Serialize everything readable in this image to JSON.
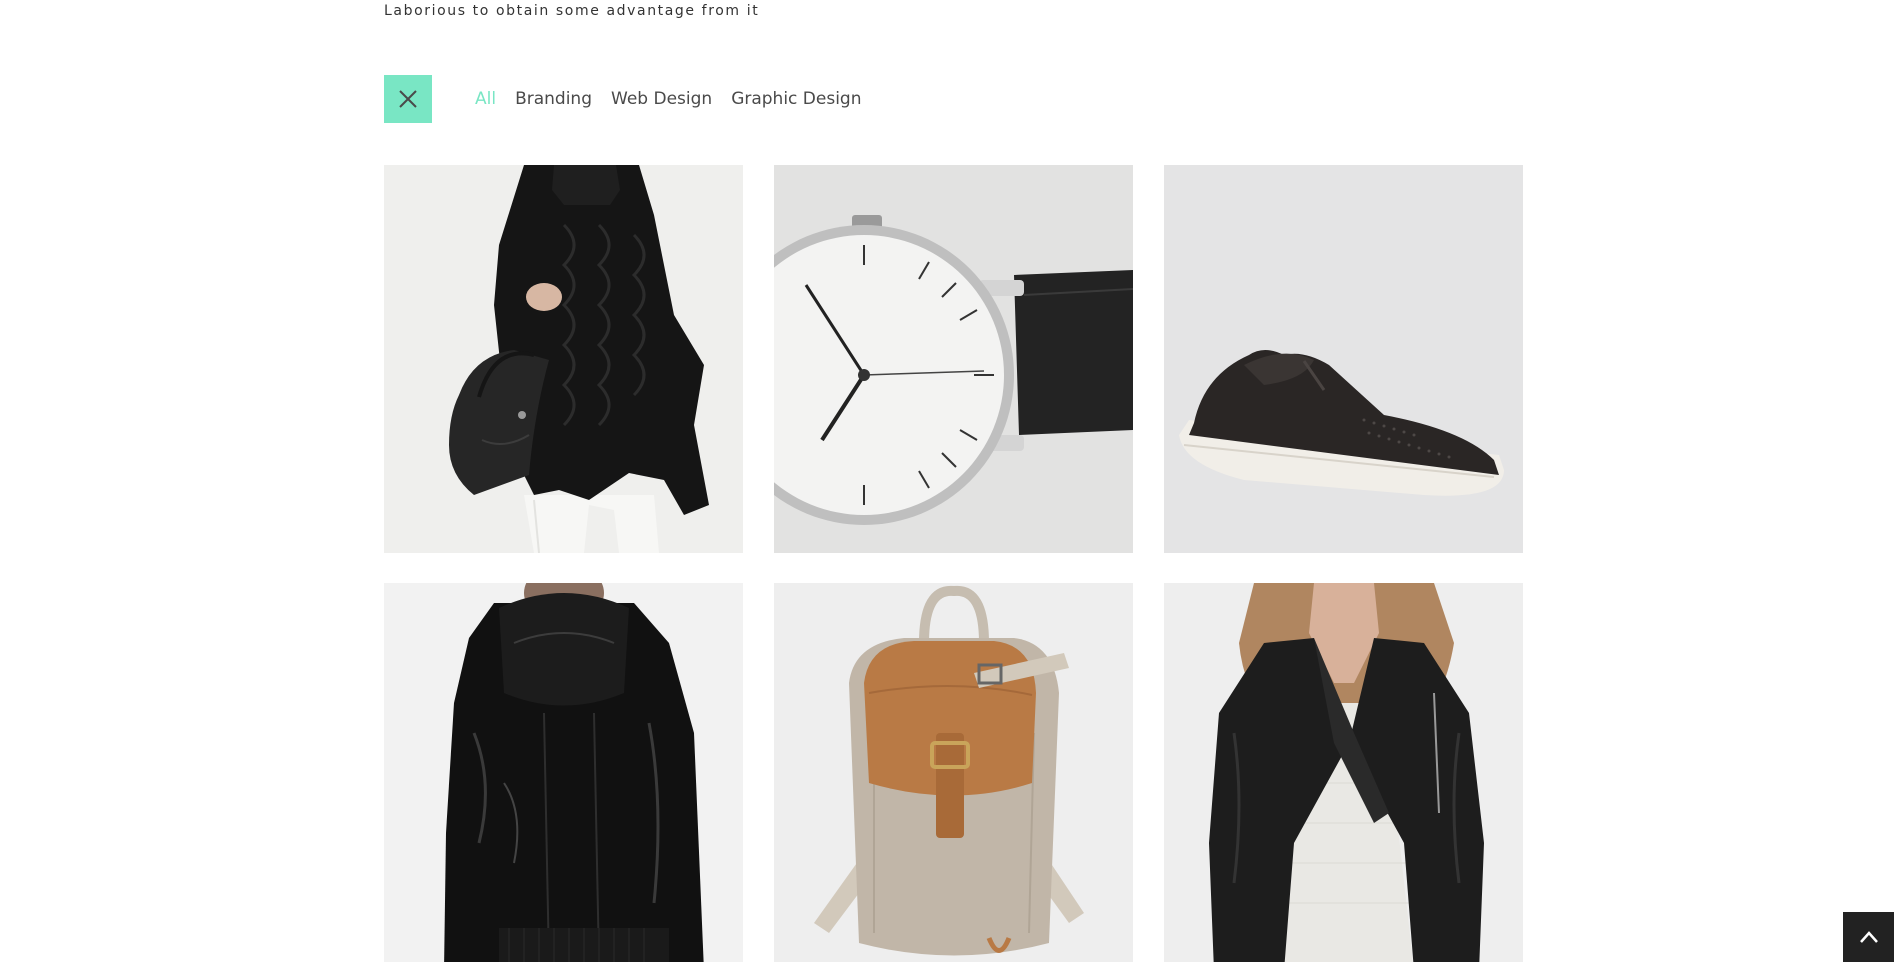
{
  "header": {
    "subtitle": "Laborious to obtain some advantage from it"
  },
  "filters": {
    "toggle_icon": "close-icon",
    "items": [
      {
        "label": "All",
        "active": true
      },
      {
        "label": "Branding",
        "active": false
      },
      {
        "label": "Web Design",
        "active": false
      },
      {
        "label": "Graphic Design",
        "active": false
      }
    ]
  },
  "portfolio": {
    "items": [
      {
        "subject": "knit-sweater-handbag-photo"
      },
      {
        "subject": "wristwatch-photo"
      },
      {
        "subject": "slip-on-sneaker-photo"
      },
      {
        "subject": "leather-hooded-jacket-photo"
      },
      {
        "subject": "canvas-backpack-photo"
      },
      {
        "subject": "leather-jacket-woman-photo"
      }
    ]
  },
  "scroll_top": {
    "icon": "chevron-up-icon"
  },
  "colors": {
    "accent": "#79e6c4",
    "text": "#4a4a4a",
    "scroll_button": "#222222"
  }
}
